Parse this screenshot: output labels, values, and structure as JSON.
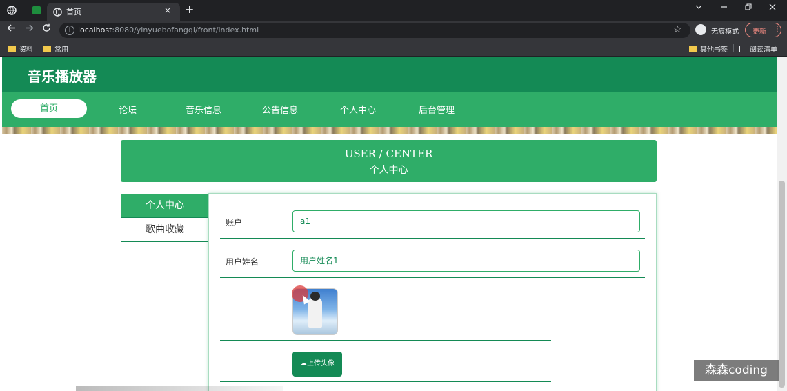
{
  "browser": {
    "tab_title": "首页",
    "tab_close": "×",
    "new_tab": "+",
    "url_host": "localhost",
    "url_rest": ":8080/yinyuebofangqi/front/index.html",
    "incognito_label": "无痕模式",
    "update_label": "更新",
    "bookmarks": [
      {
        "label": "资料"
      },
      {
        "label": "常用"
      }
    ],
    "other_bookmarks": "其他书签",
    "reading_list": "阅读清单"
  },
  "site": {
    "title": "音乐播放器",
    "nav": [
      {
        "label": "首页"
      },
      {
        "label": "论坛"
      },
      {
        "label": "音乐信息"
      },
      {
        "label": "公告信息"
      },
      {
        "label": "个人中心"
      },
      {
        "label": "后台管理"
      }
    ]
  },
  "center_banner": {
    "en": "USER / CENTER",
    "zh": "个人中心"
  },
  "side_menu": [
    {
      "label": "个人中心"
    },
    {
      "label": "歌曲收藏"
    }
  ],
  "form": {
    "account_label": "账户",
    "account_value": "a1",
    "name_label": "用户姓名",
    "name_value": "用户姓名1",
    "upload_label": "上传头像"
  },
  "watermark": "森森coding",
  "colors": {
    "header": "#148a55",
    "nav": "#2fad68",
    "accent": "#148a55"
  }
}
